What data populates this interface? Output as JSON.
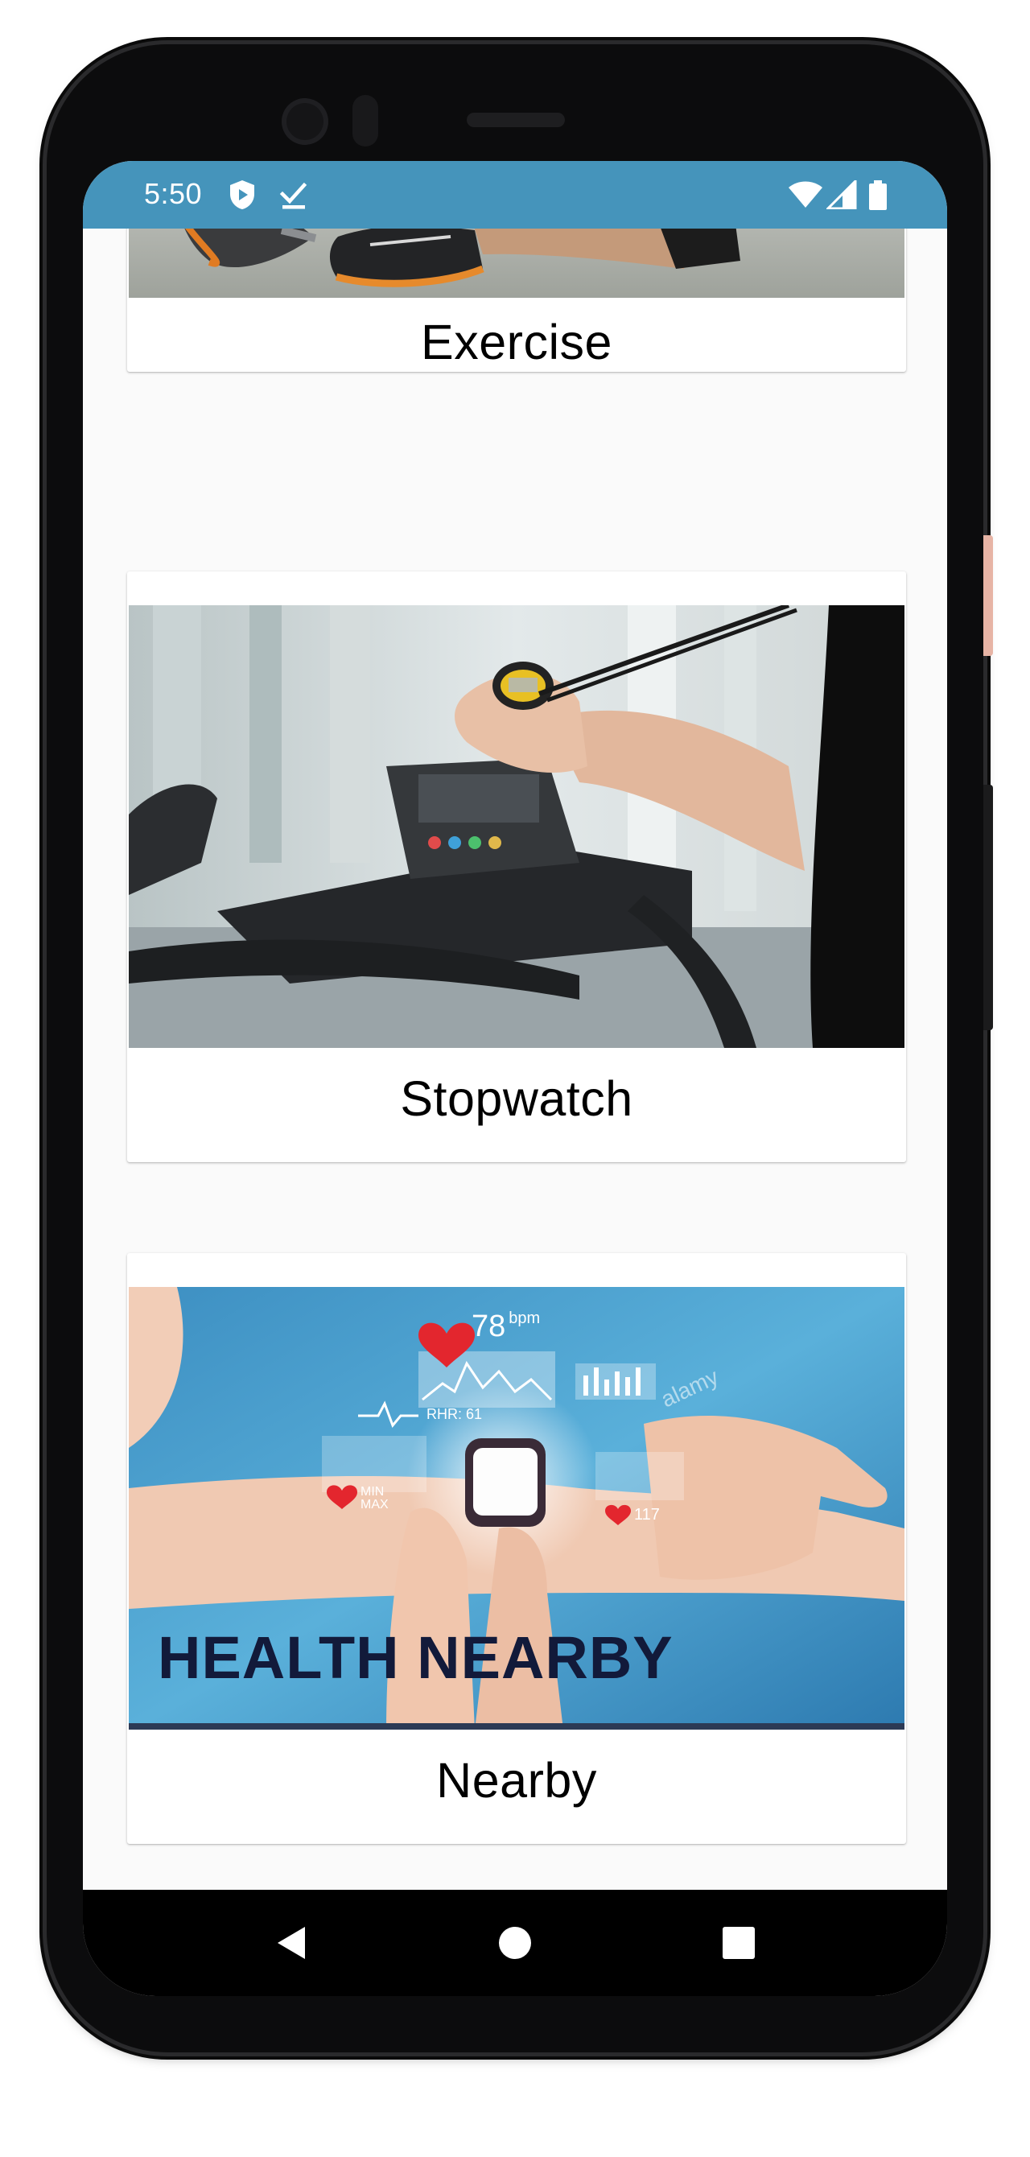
{
  "status_bar": {
    "time": "5:50",
    "left_icons": [
      "shield-icon",
      "download-done-icon"
    ],
    "right_icons": [
      "wifi-icon",
      "signal-icon",
      "battery-icon"
    ],
    "background": "#4594bb"
  },
  "cards": [
    {
      "label": "Exercise",
      "image": "exercise-shoes-photo"
    },
    {
      "label": "Stopwatch",
      "image": "stopwatch-treadmill-photo"
    },
    {
      "label": "Nearby",
      "image": "health-nearby-smartwatch-photo",
      "image_text": {
        "banner": "HEALTH NEARBY",
        "heart_rate": "78",
        "heart_rate_unit": "bpm",
        "rhr": "RHR: 61",
        "min_max": "MIN\nMAX",
        "small_bpm": "117",
        "watermark": "alamy"
      }
    }
  ],
  "nav": {
    "back": "back-icon",
    "home": "home-icon",
    "recents": "recents-icon"
  }
}
